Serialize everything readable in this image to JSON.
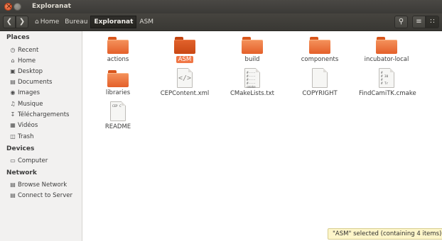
{
  "window": {
    "title": "Exploranat"
  },
  "toolbar": {
    "back_icon": "chevron-left",
    "forward_icon": "chevron-right",
    "breadcrumbs": [
      {
        "label": "Home",
        "icon": "home-icon"
      },
      {
        "label": "Bureau"
      },
      {
        "label": "Exploranat",
        "active": true
      },
      {
        "label": "ASM"
      }
    ],
    "search_icon": "search-icon",
    "list_view_icon": "list-view-icon",
    "grid_view_icon": "grid-view-icon"
  },
  "sidebar": {
    "sections": [
      {
        "heading": "Places",
        "items": [
          {
            "label": "Recent",
            "icon": "clock-icon"
          },
          {
            "label": "Home",
            "icon": "home-icon"
          },
          {
            "label": "Desktop",
            "icon": "desktop-icon"
          },
          {
            "label": "Documents",
            "icon": "documents-icon"
          },
          {
            "label": "Images",
            "icon": "camera-icon"
          },
          {
            "label": "Musique",
            "icon": "music-icon"
          },
          {
            "label": "Téléchargements",
            "icon": "download-icon"
          },
          {
            "label": "Vidéos",
            "icon": "film-icon"
          },
          {
            "label": "Trash",
            "icon": "trash-icon"
          }
        ]
      },
      {
        "heading": "Devices",
        "items": [
          {
            "label": "Computer",
            "icon": "computer-icon"
          }
        ]
      },
      {
        "heading": "Network",
        "items": [
          {
            "label": "Browse Network",
            "icon": "network-icon"
          },
          {
            "label": "Connect to Server",
            "icon": "server-icon"
          }
        ]
      }
    ]
  },
  "files": [
    {
      "name": "actions",
      "type": "folder"
    },
    {
      "name": "ASM",
      "type": "folder",
      "selected": true
    },
    {
      "name": "build",
      "type": "folder"
    },
    {
      "name": "components",
      "type": "folder"
    },
    {
      "name": "incubator-local",
      "type": "folder"
    },
    {
      "name": "libraries",
      "type": "folder"
    },
    {
      "name": "CEPContent.xml",
      "type": "xml"
    },
    {
      "name": "CMakeLists.txt",
      "type": "text"
    },
    {
      "name": "COPYRIGHT",
      "type": "plain"
    },
    {
      "name": "FindCamiTK.cmake",
      "type": "cmake"
    },
    {
      "name": "README",
      "type": "readme"
    }
  ],
  "status": {
    "text": "\"ASM\" selected  (containing 4 items)"
  }
}
